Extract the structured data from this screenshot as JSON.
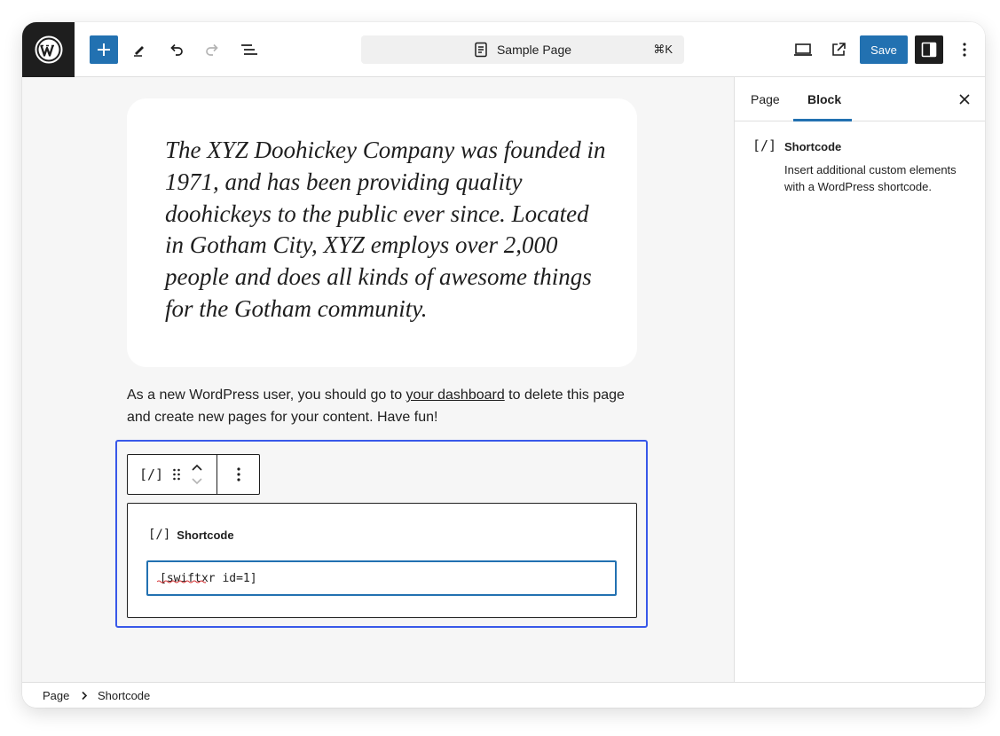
{
  "header": {
    "document_title": "Sample Page",
    "shortcut": "⌘K",
    "save_label": "Save"
  },
  "icons": {
    "logo": "wordpress-logo-icon",
    "add": "plus-icon",
    "tools": "pen-icon",
    "undo": "undo-icon",
    "redo": "redo-icon",
    "outline": "list-view-icon",
    "view": "laptop-icon",
    "external": "external-link-icon",
    "settings": "sidebar-toggle-icon",
    "more": "vertical-dots-icon",
    "close": "close-icon"
  },
  "colors": {
    "accent": "#2271b1",
    "selection": "#3858e9",
    "dark": "#1e1e1e"
  },
  "content": {
    "quote": "The XYZ Doohickey Company was founded in 1971, and has been providing quality doohickeys to the public ever since. Located in Gotham City, XYZ employs over 2,000 people and does all kinds of awesome things for the Gotham community.",
    "paragraph_before": "As a new WordPress user, you should go to ",
    "paragraph_link": "your dashboard",
    "paragraph_after": " to delete this page and create new pages for your content. Have fun!"
  },
  "block": {
    "toolbar_glyph": "[/]",
    "label_glyph": "[/]",
    "label": "Shortcode",
    "input_value": "[swiftxr id=1]"
  },
  "sidebar": {
    "tabs": [
      "Page",
      "Block"
    ],
    "active_tab": "Block",
    "block_glyph": "[/]",
    "block_title": "Shortcode",
    "block_description": "Insert additional custom elements with a WordPress shortcode."
  },
  "breadcrumb": {
    "items": [
      "Page",
      "Shortcode"
    ]
  }
}
